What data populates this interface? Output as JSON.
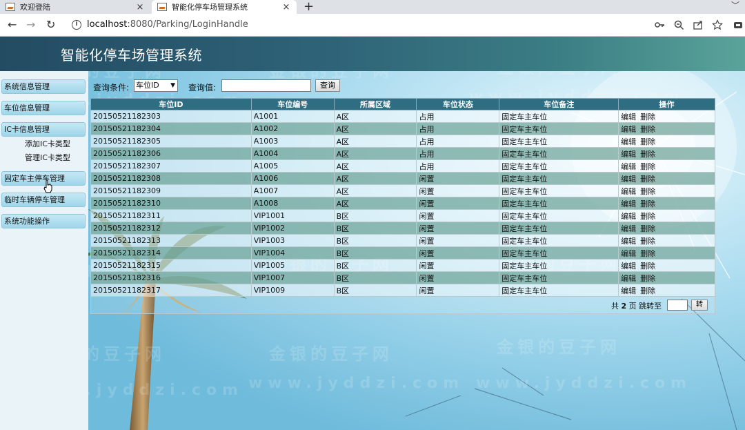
{
  "browser": {
    "tabs": [
      {
        "title": "欢迎登陆",
        "close": "×"
      },
      {
        "title": "智能化停车场管理系统",
        "close": "×"
      }
    ],
    "new_tab": "+",
    "url_host": "localhost",
    "url_rest": ":8080/Parking/LoginHandle"
  },
  "app": {
    "title": "智能化停车场管理系统",
    "watermark_text": "金银的豆子网",
    "watermark_url": "www.jyddzi.com"
  },
  "sidebar": {
    "items": [
      {
        "label": "系统信息管理"
      },
      {
        "label": "车位信息管理"
      },
      {
        "label": "IC卡信息管理"
      },
      {
        "label": "固定车主停车管理"
      },
      {
        "label": "临时车辆停车管理"
      },
      {
        "label": "系统功能操作"
      }
    ],
    "subitems": [
      {
        "label": "添加IC卡类型"
      },
      {
        "label": "管理IC卡类型"
      }
    ]
  },
  "search": {
    "condition_label": "查询条件:",
    "condition_value": "车位ID",
    "value_label": "查询值:",
    "value": "",
    "button": "查询"
  },
  "table": {
    "headers": [
      "车位ID",
      "车位编号",
      "所属区域",
      "车位状态",
      "车位备注",
      "操作"
    ],
    "rows": [
      [
        "20150521182303",
        "A1001",
        "A区",
        "占用",
        "固定车主车位"
      ],
      [
        "20150521182304",
        "A1002",
        "A区",
        "占用",
        "固定车主车位"
      ],
      [
        "20150521182305",
        "A1003",
        "A区",
        "占用",
        "固定车主车位"
      ],
      [
        "20150521182306",
        "A1004",
        "A区",
        "占用",
        "固定车主车位"
      ],
      [
        "20150521182307",
        "A1005",
        "A区",
        "占用",
        "固定车主车位"
      ],
      [
        "20150521182308",
        "A1006",
        "A区",
        "闲置",
        "固定车主车位"
      ],
      [
        "20150521182309",
        "A1007",
        "A区",
        "闲置",
        "固定车主车位"
      ],
      [
        "20150521182310",
        "A1008",
        "A区",
        "闲置",
        "固定车主车位"
      ],
      [
        "20150521182311",
        "VIP1001",
        "B区",
        "闲置",
        "固定车主车位"
      ],
      [
        "20150521182312",
        "VIP1002",
        "B区",
        "闲置",
        "固定车主车位"
      ],
      [
        "20150521182313",
        "VIP1003",
        "B区",
        "闲置",
        "固定车主车位"
      ],
      [
        "20150521182314",
        "VIP1004",
        "B区",
        "闲置",
        "固定车主车位"
      ],
      [
        "20150521182315",
        "VIP1005",
        "B区",
        "闲置",
        "固定车主车位"
      ],
      [
        "20150521182316",
        "VIP1007",
        "B区",
        "闲置",
        "固定车主车位"
      ],
      [
        "20150521182317",
        "VIP1009",
        "B区",
        "闲置",
        "固定车主车位"
      ]
    ],
    "edit_label": "编辑",
    "delete_label": "删除"
  },
  "pager": {
    "prefix": "共",
    "pages": "2",
    "suffix": "页 跳转至",
    "button": "转"
  },
  "colors": {
    "header_bar": "#2f6478",
    "table_header": "#2f6d83",
    "row_alt": "#84b2a8",
    "menu_item": "#9fd6ea"
  }
}
